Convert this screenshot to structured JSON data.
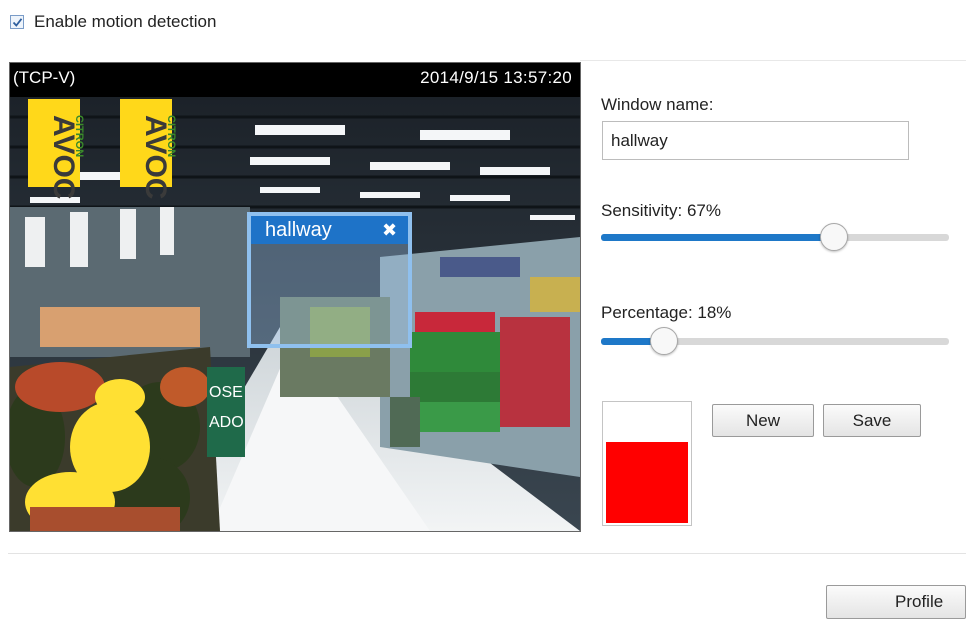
{
  "motion_detection": {
    "checkbox_label": "Enable motion detection",
    "enabled": true
  },
  "video": {
    "protocol": "(TCP-V)",
    "timestamp": "2014/9/15 13:57:20",
    "scene_signs": [
      "AVOC",
      "AVOC",
      "CITRON",
      "CITRON",
      "OSE",
      "ADO"
    ]
  },
  "motion_window": {
    "name": "hallway",
    "close_glyph": "✖"
  },
  "settings": {
    "window_name_label": "Window name:",
    "window_name_value": "hallway",
    "sensitivity_label": "Sensitivity: 67%",
    "sensitivity_value": 67,
    "percentage_label": "Percentage: 18%",
    "percentage_value": 18,
    "activity_level": 0.68
  },
  "buttons": {
    "new_label": "New",
    "save_label": "Save",
    "profile_label": "Profile"
  },
  "colors": {
    "accent": "#1e73c8",
    "slider_fill": "#1e78c8",
    "meter_fill": "#ff0000"
  }
}
